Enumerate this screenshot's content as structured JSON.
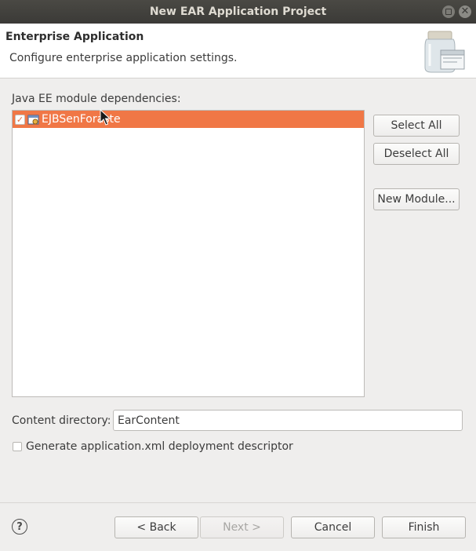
{
  "window": {
    "title": "New EAR Application Project"
  },
  "header": {
    "title": "Enterprise Application",
    "description": "Configure enterprise application settings.",
    "banner_icon": "jar-window-icon"
  },
  "dependencies": {
    "label": "Java EE module dependencies:",
    "items": [
      {
        "label": "EJBSenForaste",
        "checked": true,
        "selected": true,
        "icon": "ejb-module-icon"
      }
    ]
  },
  "side_buttons": {
    "select_all": "Select All",
    "deselect_all": "Deselect All",
    "new_module": "New Module..."
  },
  "content_directory": {
    "label": "Content directory:",
    "value": "EarContent"
  },
  "generate_descriptor": {
    "label": "Generate application.xml deployment descriptor",
    "checked": false
  },
  "footer": {
    "help_icon": "help-icon",
    "back": "< Back",
    "next": "Next >",
    "cancel": "Cancel",
    "finish": "Finish"
  },
  "colors": {
    "selection": "#f07746",
    "titlebar": "#3b3a37"
  }
}
